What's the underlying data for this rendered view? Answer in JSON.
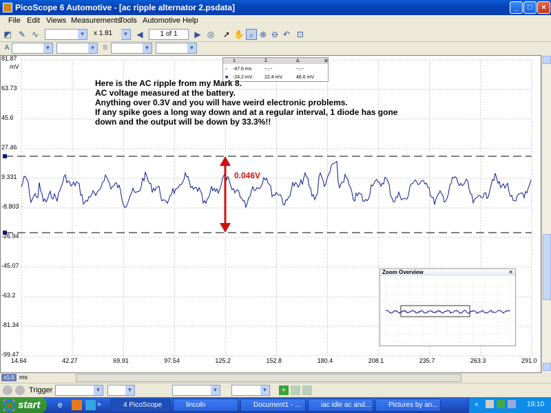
{
  "window": {
    "title": "PicoScope 6 Automotive - [ac ripple alternator 2.psdata]",
    "minimize": "_",
    "maximize": "□",
    "close": "×"
  },
  "menu": [
    "File",
    "Edit",
    "Views",
    "Measurements",
    "Tools",
    "Automotive",
    "Help"
  ],
  "toolbar": {
    "zoom": "x 1.81",
    "page": "1 of 1"
  },
  "chart": {
    "y_unit": "mV",
    "x_unit": "ms",
    "y_ticks": [
      "81.87",
      "63.73",
      "45.6",
      "27.46",
      "9.331",
      "-8.803",
      "-26.94",
      "-45.07",
      "-63.2",
      "-81.34",
      "-99.47"
    ],
    "x_ticks": [
      "14.64",
      "42.27",
      "69.91",
      "97.54",
      "125.2",
      "152.8",
      "180.4",
      "208.1",
      "235.7",
      "263.3",
      "291.0"
    ],
    "x_zoom": "x1.0"
  },
  "annotation": {
    "lines": [
      "Here is the AC ripple from my Mark 8.",
      "AC voltage measured at the battery.",
      "Anything over 0.3V and you will have weird electronic problems.",
      "If any spike goes a long way down and at a regular interval, 1 diode has gone",
      "down and the output will be down by 33.3%!!"
    ],
    "arrow_label": "0.046V",
    "arrow_color": "#d01010"
  },
  "ruler_table": {
    "headers": [
      "1",
      "2",
      "Δ"
    ],
    "row1": [
      "-47.6 ms",
      "--,--",
      "--,--"
    ],
    "row2": [
      "-24.2 mV",
      "22.4 mV",
      "46.6 mV"
    ]
  },
  "zoom_overview": {
    "title": "Zoom Overview"
  },
  "statusbar": {
    "trigger_label": "Trigger"
  },
  "taskbar": {
    "start": "start",
    "items": [
      "4 PicoScope",
      "lincoln",
      "Document1 - ...",
      "iac idle ac and...",
      "Pictures by an..."
    ],
    "clock": "19:10"
  },
  "colors": {
    "trace": "#0a1a8c",
    "grid": "#c8c8c8",
    "title_bar": "#0a5bd6",
    "arrow": "#d01010"
  }
}
